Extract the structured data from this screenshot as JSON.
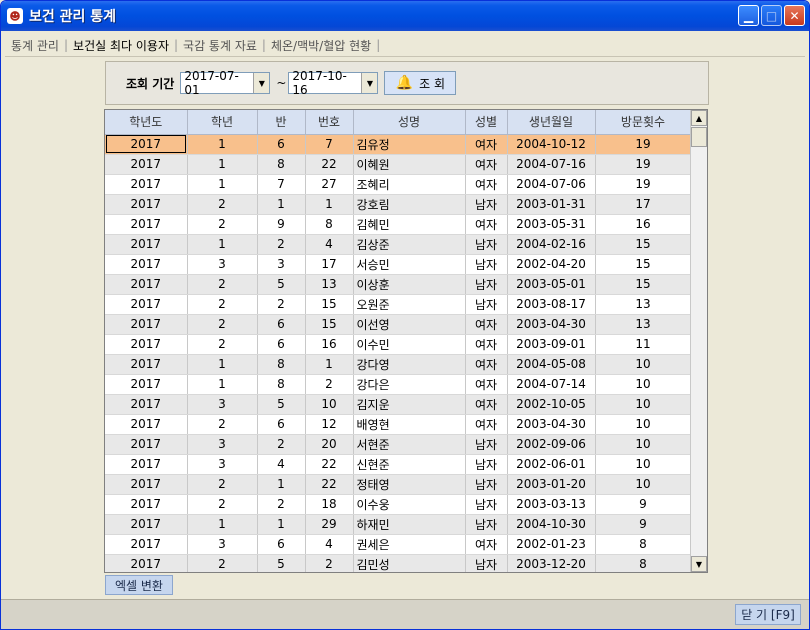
{
  "window": {
    "title": "보건 관리 통계"
  },
  "menu": [
    "통계 관리",
    "보건실 최다 이용자",
    "국감 통계 자료",
    "체온/맥박/혈압 현황"
  ],
  "filter": {
    "label": "조회 기간",
    "date_from": "2017-07-01",
    "tilde": "~",
    "date_to": "2017-10-16",
    "search_label": "조 회"
  },
  "table": {
    "columns": [
      "학년도",
      "학년",
      "반",
      "번호",
      "성명",
      "성별",
      "생년월일",
      "방문횟수"
    ],
    "rows": [
      [
        "2017",
        "1",
        "6",
        "7",
        "김유정",
        "여자",
        "2004-10-12",
        "19"
      ],
      [
        "2017",
        "1",
        "8",
        "22",
        "이혜원",
        "여자",
        "2004-07-16",
        "19"
      ],
      [
        "2017",
        "1",
        "7",
        "27",
        "조혜리",
        "여자",
        "2004-07-06",
        "19"
      ],
      [
        "2017",
        "2",
        "1",
        "1",
        "강호림",
        "남자",
        "2003-01-31",
        "17"
      ],
      [
        "2017",
        "2",
        "9",
        "8",
        "김혜민",
        "여자",
        "2003-05-31",
        "16"
      ],
      [
        "2017",
        "1",
        "2",
        "4",
        "김상준",
        "남자",
        "2004-02-16",
        "15"
      ],
      [
        "2017",
        "3",
        "3",
        "17",
        "서승민",
        "남자",
        "2002-04-20",
        "15"
      ],
      [
        "2017",
        "2",
        "5",
        "13",
        "이상훈",
        "남자",
        "2003-05-01",
        "15"
      ],
      [
        "2017",
        "2",
        "2",
        "15",
        "오원준",
        "남자",
        "2003-08-17",
        "13"
      ],
      [
        "2017",
        "2",
        "6",
        "15",
        "이선영",
        "여자",
        "2003-04-30",
        "13"
      ],
      [
        "2017",
        "2",
        "6",
        "16",
        "이수민",
        "여자",
        "2003-09-01",
        "11"
      ],
      [
        "2017",
        "1",
        "8",
        "1",
        "강다영",
        "여자",
        "2004-05-08",
        "10"
      ],
      [
        "2017",
        "1",
        "8",
        "2",
        "강다은",
        "여자",
        "2004-07-14",
        "10"
      ],
      [
        "2017",
        "3",
        "5",
        "10",
        "김지운",
        "여자",
        "2002-10-05",
        "10"
      ],
      [
        "2017",
        "2",
        "6",
        "12",
        "배영현",
        "여자",
        "2003-04-30",
        "10"
      ],
      [
        "2017",
        "3",
        "2",
        "20",
        "서현준",
        "남자",
        "2002-09-06",
        "10"
      ],
      [
        "2017",
        "3",
        "4",
        "22",
        "신현준",
        "남자",
        "2002-06-01",
        "10"
      ],
      [
        "2017",
        "2",
        "1",
        "22",
        "정태영",
        "남자",
        "2003-01-20",
        "10"
      ],
      [
        "2017",
        "2",
        "2",
        "18",
        "이수웅",
        "남자",
        "2003-03-13",
        "9"
      ],
      [
        "2017",
        "1",
        "1",
        "29",
        "하재민",
        "남자",
        "2004-10-30",
        "9"
      ],
      [
        "2017",
        "3",
        "6",
        "4",
        "권세은",
        "여자",
        "2002-01-23",
        "8"
      ],
      [
        "2017",
        "2",
        "5",
        "2",
        "김민성",
        "남자",
        "2003-12-20",
        "8"
      ]
    ],
    "selected_index": 0
  },
  "buttons": {
    "excel": "엑셀 변환",
    "close": "닫 기 [F9]"
  },
  "colors": {
    "titlebar": "#0050E0",
    "selected_row": "#F8C08C",
    "header": "#D7E1F2"
  }
}
